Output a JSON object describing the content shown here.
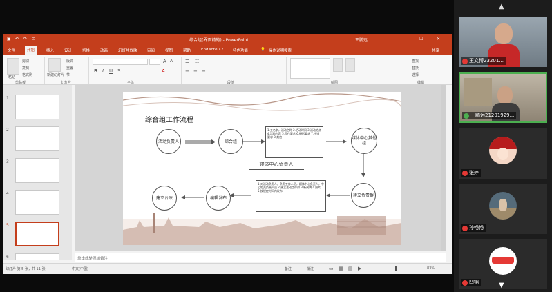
{
  "ppt": {
    "title": "综合组(界面前的) - PowerPoint",
    "user": "王鹏远",
    "tabs": [
      "文件",
      "开始",
      "插入",
      "设计",
      "切换",
      "动画",
      "幻灯片放映",
      "审阅",
      "视图",
      "帮助",
      "EndNote X7",
      "特色功能",
      "操作说明搜索"
    ],
    "share_label": "共享",
    "ribbon_groups": [
      "剪贴板",
      "幻灯片",
      "字体",
      "段落",
      "绘图",
      "编辑"
    ],
    "clipboard": {
      "cut": "剪切",
      "copy": "复制",
      "paste": "粘贴",
      "format": "格式刷"
    },
    "slides_group": {
      "new": "新建幻灯片",
      "layout": "版式",
      "reset": "重置",
      "section": "节"
    },
    "editing": {
      "find": "查找",
      "replace": "替换",
      "select": "选择"
    },
    "thumb_numbers": [
      "1",
      "2",
      "3",
      "4",
      "5",
      "6"
    ],
    "notes_placeholder": "单击此处添加备注",
    "status_left": "幻灯片 第 5 张，共 11 张",
    "status_lang": "中文(中国)",
    "status_notes": "备注",
    "status_comments": "批注",
    "zoom": "83%"
  },
  "slide": {
    "title": "综合组工作流程",
    "node_activity_owner": "活动负责人",
    "node_general": "综合组",
    "node_media_center": "媒体中心其他组",
    "node_review": "建立负责群",
    "node_edit_publish": "编辑发布",
    "node_archive": "建立台账",
    "media_owner_label": "媒体中心负责人",
    "box_top": "1.五名字，活动名称 2.活动时间 3.活动地点 4.活动内容 5.写作要求 6.摄影要求 7.出镜要求 8.其他",
    "box_bottom": "1.对活动负责人，负责工作人员，媒体中心负责人，中心相关负责人员 2.建立活动工作群 3.新闻稿 4.照片 5.按规定时间内发布"
  },
  "participants": [
    {
      "name": "王文博23201...",
      "mic": "muted"
    },
    {
      "name": "王鹏远21201929...",
      "mic": "speaking"
    },
    {
      "name": "张婷",
      "mic": "muted"
    },
    {
      "name": "孙畅畅",
      "mic": "muted"
    },
    {
      "name": "凹锦",
      "mic": "muted"
    }
  ],
  "colors": {
    "ppt_brand": "#c43e1c",
    "speaking": "#4caf50",
    "muted": "#e53935"
  }
}
